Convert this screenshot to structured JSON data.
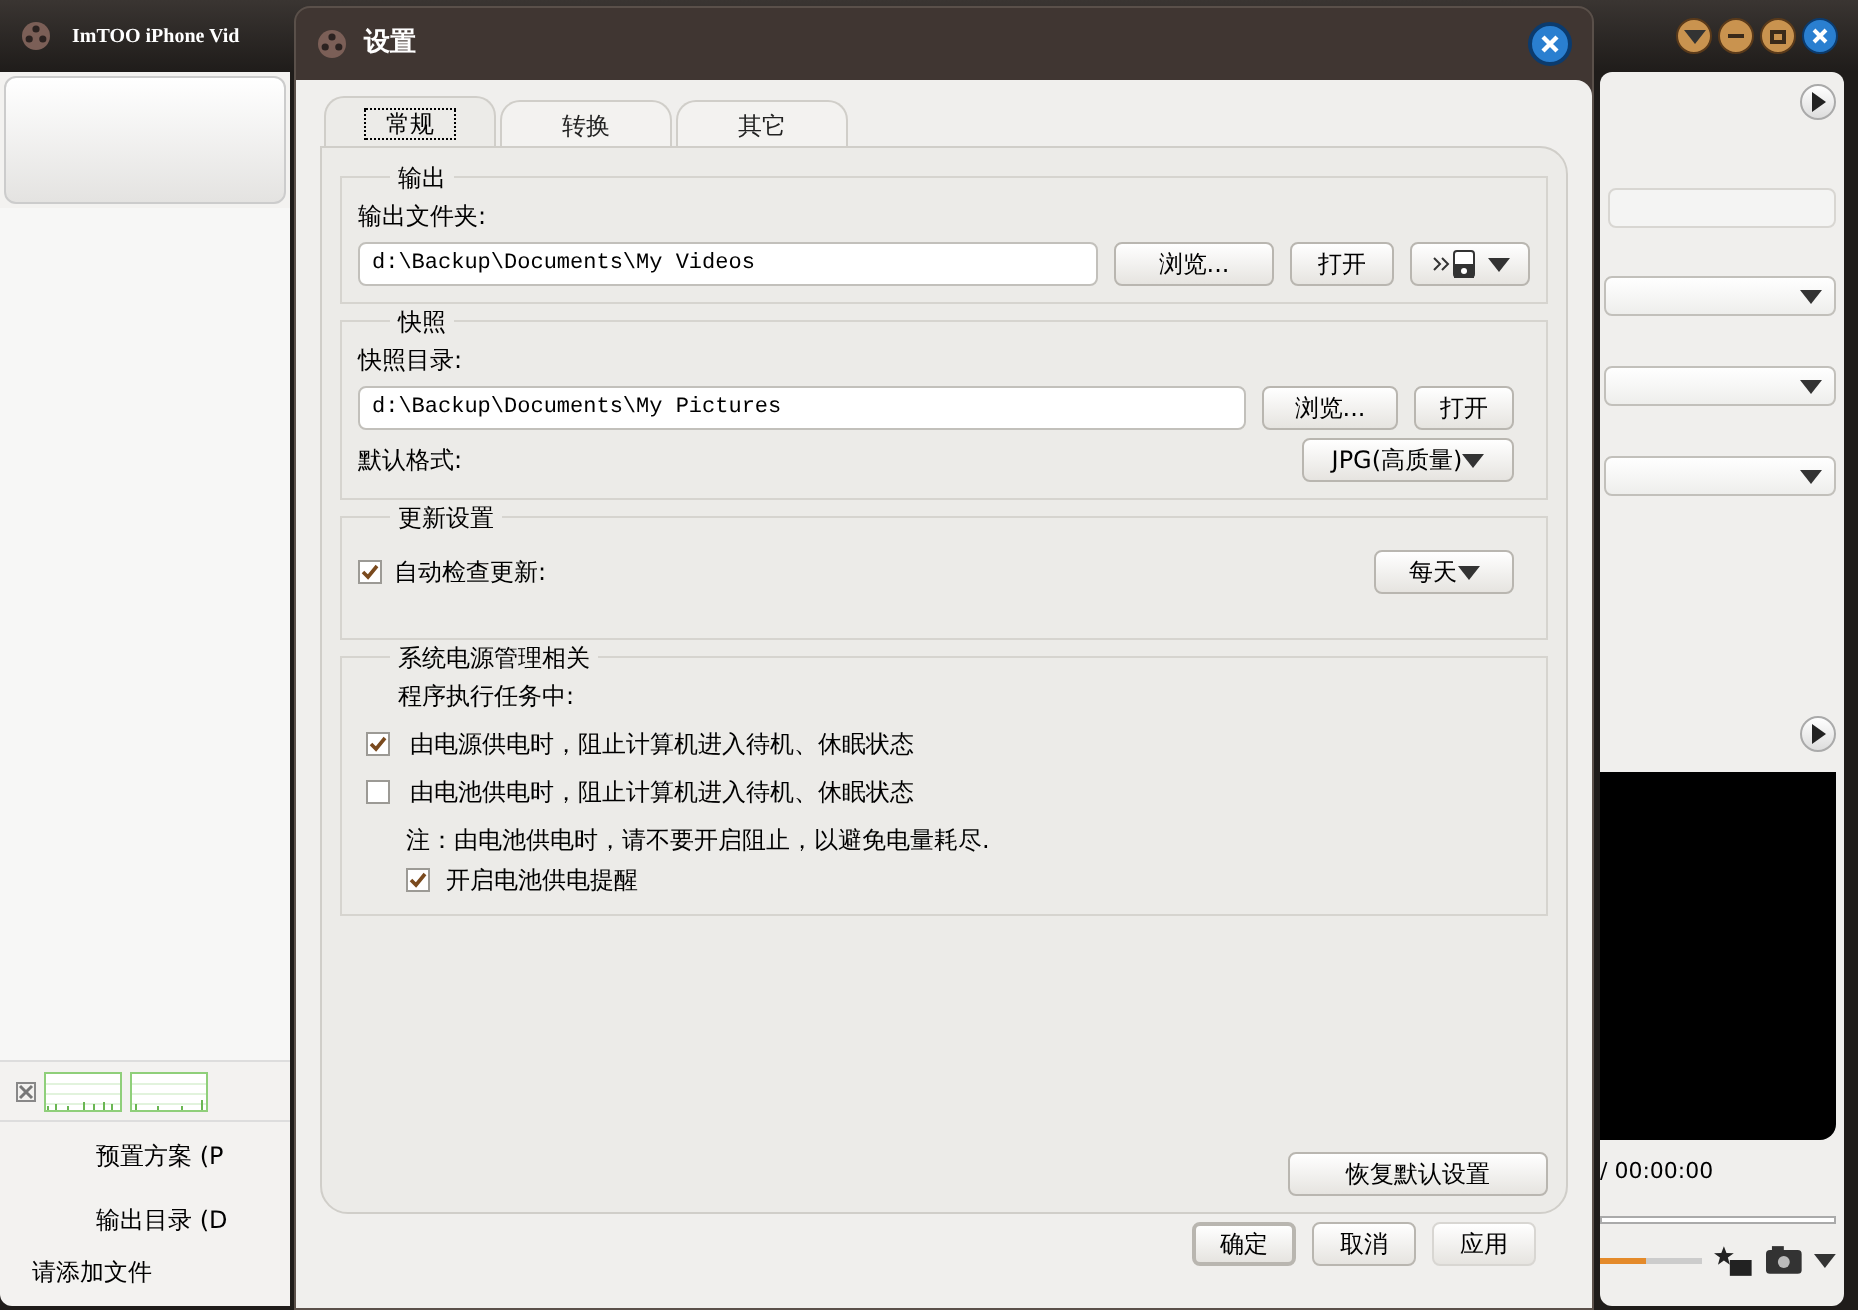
{
  "app": {
    "title": "ImTOO iPhone Vid",
    "left_panel": {
      "preset_label": "预置方案 (P",
      "output_label": "输出目录 (D",
      "status": "请添加文件"
    },
    "right_panel": {
      "time": "/ 00:00:00",
      "volume": {
        "level": 0.45
      }
    }
  },
  "dialog": {
    "title": "设置",
    "tabs": [
      {
        "label": "常规",
        "selected": true
      },
      {
        "label": "转换",
        "selected": false
      },
      {
        "label": "其它",
        "selected": false
      }
    ],
    "output": {
      "legend": "输出",
      "folder_label": "输出文件夹:",
      "path": "d:\\Backup\\Documents\\My Videos",
      "browse": "浏览...",
      "open": "打开"
    },
    "snapshot": {
      "legend": "快照",
      "folder_label": "快照目录:",
      "path": "d:\\Backup\\Documents\\My Pictures",
      "browse": "浏览...",
      "open": "打开",
      "format_label": "默认格式:",
      "format": "JPG(高质量)"
    },
    "update": {
      "legend": "更新设置",
      "auto_check": {
        "label": "自动检查更新:",
        "checked": true
      },
      "frequency": "每天"
    },
    "power": {
      "legend": "系统电源管理相关",
      "intro": "程序执行任务中:",
      "options": [
        {
          "label": "由电源供电时，阻止计算机进入待机、休眠状态",
          "checked": true
        },
        {
          "label": "由电池供电时，阻止计算机进入待机、休眠状态",
          "checked": false
        }
      ],
      "note": "注：由电池供电时，请不要开启阻止，以避免电量耗尽.",
      "reminder": {
        "label": "开启电池供电提醒",
        "checked": true
      }
    },
    "restore_button": "恢复默认设置",
    "buttons": [
      {
        "label": "确定",
        "default": true,
        "disabled": false
      },
      {
        "label": "取消",
        "default": false,
        "disabled": false
      },
      {
        "label": "应用",
        "default": false,
        "disabled": true
      }
    ]
  }
}
